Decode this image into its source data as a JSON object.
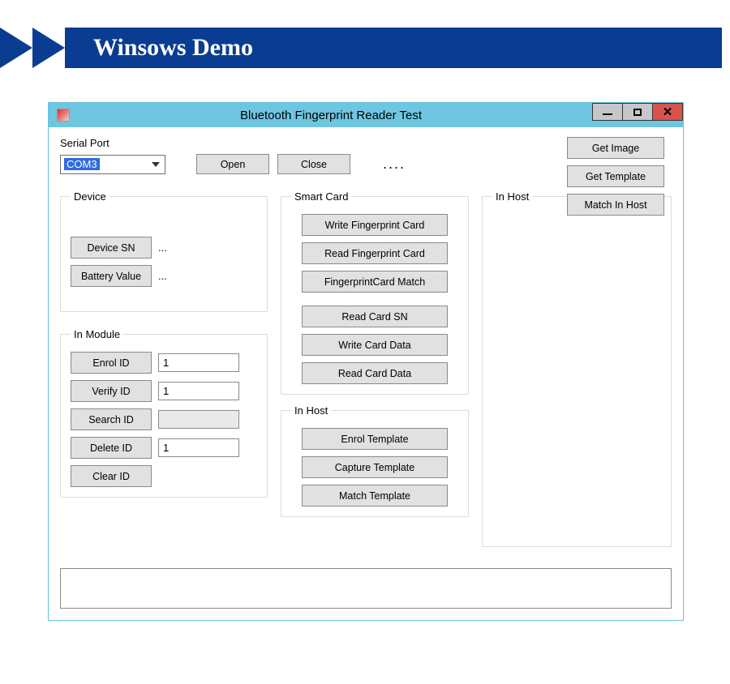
{
  "banner": {
    "title": "Winsows Demo"
  },
  "window": {
    "title": "Bluetooth Fingerprint Reader Test"
  },
  "serial_port": {
    "label": "Serial Port",
    "selected": "COM3",
    "open_label": "Open",
    "close_label": "Close",
    "status": "...."
  },
  "device_group": {
    "legend": "Device",
    "device_sn_label": "Device SN",
    "device_sn_value": "...",
    "battery_label": "Battery Value",
    "battery_value": "..."
  },
  "in_module_group": {
    "legend": "In Module",
    "enrol_id_label": "Enrol ID",
    "enrol_id_value": "1",
    "verify_id_label": "Verify ID",
    "verify_id_value": "1",
    "search_id_label": "Search ID",
    "search_id_value": "",
    "delete_id_label": "Delete ID",
    "delete_id_value": "1",
    "clear_id_label": "Clear ID"
  },
  "smart_card_group": {
    "legend": "Smart Card",
    "write_fp_card": "Write Fingerprint Card",
    "read_fp_card": "Read Fingerprint Card",
    "fp_card_match": "FingerprintCard Match",
    "read_card_sn": "Read Card SN",
    "write_card_data": "Write Card Data",
    "read_card_data": "Read Card Data"
  },
  "in_host_center_group": {
    "legend": "In Host",
    "enrol_template": "Enrol Template",
    "capture_template": "Capture Template",
    "match_template": "Match Template"
  },
  "in_host_right_group": {
    "legend": "In Host",
    "get_image": "Get Image",
    "get_template": "Get Template",
    "match_in_host": "Match In Host"
  },
  "log": {
    "text": ""
  }
}
